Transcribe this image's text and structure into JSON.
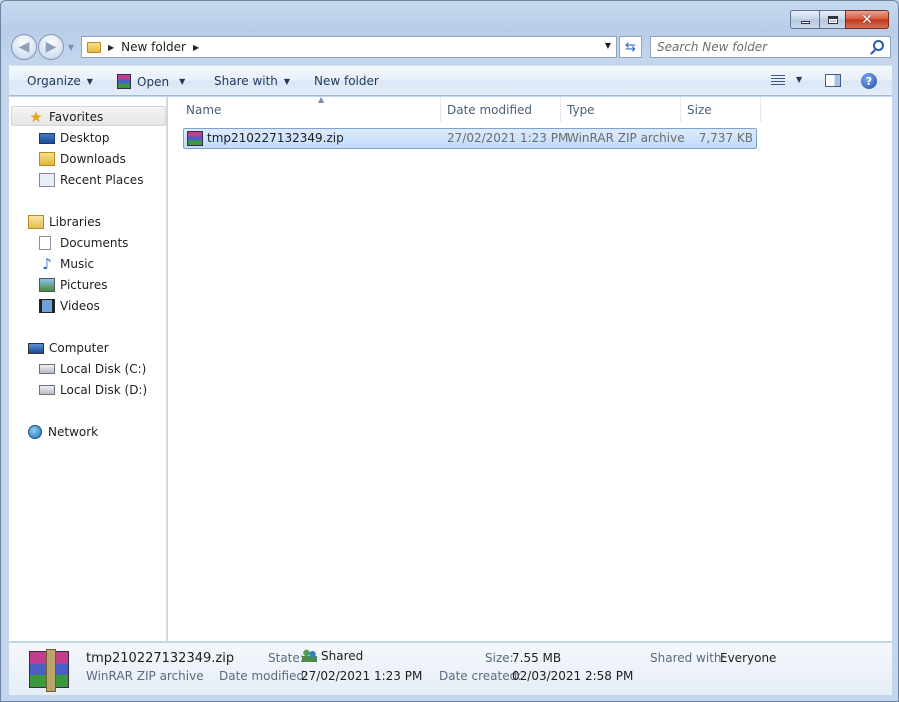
{
  "window": {
    "caption": {
      "minimize": "—",
      "maximize": "□",
      "close": "✕"
    }
  },
  "address": {
    "path": [
      "New folder"
    ],
    "search_placeholder": "Search New folder"
  },
  "toolbar": {
    "organize": "Organize",
    "open": "Open",
    "share_with": "Share with",
    "new_folder": "New folder"
  },
  "sidebar": {
    "favorites": {
      "label": "Favorites",
      "items": [
        {
          "label": "Desktop",
          "icon": "desktop-icon"
        },
        {
          "label": "Downloads",
          "icon": "downloads-folder-icon"
        },
        {
          "label": "Recent Places",
          "icon": "recent-places-icon"
        }
      ]
    },
    "libraries": {
      "label": "Libraries",
      "items": [
        {
          "label": "Documents",
          "icon": "documents-icon"
        },
        {
          "label": "Music",
          "icon": "music-icon"
        },
        {
          "label": "Pictures",
          "icon": "pictures-icon"
        },
        {
          "label": "Videos",
          "icon": "videos-icon"
        }
      ]
    },
    "computer": {
      "label": "Computer",
      "items": [
        {
          "label": "Local Disk (C:)",
          "icon": "disk-icon"
        },
        {
          "label": "Local Disk (D:)",
          "icon": "disk-icon"
        }
      ]
    },
    "network": {
      "label": "Network"
    }
  },
  "file_list": {
    "columns": [
      "Name",
      "Date modified",
      "Type",
      "Size"
    ],
    "rows": [
      {
        "name": "tmp210227132349.zip",
        "date_modified": "27/02/2021 1:23 PM",
        "type": "WinRAR ZIP archive",
        "size": "7,737 KB",
        "selected": true
      }
    ]
  },
  "details": {
    "filename": "tmp210227132349.zip",
    "filetype": "WinRAR ZIP archive",
    "state_label": "State:",
    "state_value": "Shared",
    "date_modified_label": "Date modified:",
    "date_modified_value": "27/02/2021 1:23 PM",
    "size_label": "Size:",
    "size_value": "7.55 MB",
    "date_created_label": "Date created:",
    "date_created_value": "02/03/2021 2:58 PM",
    "shared_with_label": "Shared with:",
    "shared_with_value": "Everyone"
  },
  "colors": {
    "selection": "#c1dbfc",
    "command_text": "#1e395b",
    "chrome": "#c4d6ec"
  }
}
